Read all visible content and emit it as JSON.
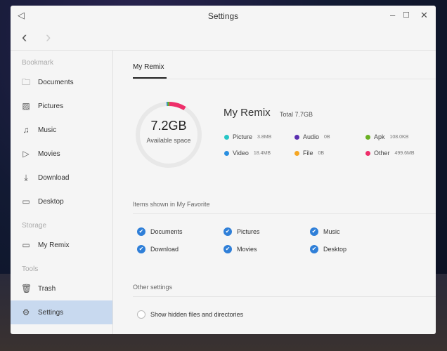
{
  "window": {
    "title": "Settings"
  },
  "sidebar": {
    "bookmark_label": "Bookmark",
    "bookmarks": [
      {
        "label": "Documents",
        "icon": "folder-icon"
      },
      {
        "label": "Pictures",
        "icon": "image-icon"
      },
      {
        "label": "Music",
        "icon": "music-icon"
      },
      {
        "label": "Movies",
        "icon": "play-icon"
      },
      {
        "label": "Download",
        "icon": "download-icon"
      },
      {
        "label": "Desktop",
        "icon": "desktop-icon"
      }
    ],
    "storage_label": "Storage",
    "storage": [
      {
        "label": "My Remix",
        "icon": "monitor-icon"
      }
    ],
    "tools_label": "Tools",
    "tools": [
      {
        "label": "Trash",
        "icon": "trash-icon"
      },
      {
        "label": "Settings",
        "icon": "gear-icon"
      }
    ]
  },
  "main": {
    "tab": "My Remix",
    "disk": {
      "available": "7.2GB",
      "available_label": "Available space",
      "name": "My Remix",
      "total": "Total 7.7GB"
    },
    "legend": [
      {
        "label": "Picture",
        "value": "3.8MB",
        "color": "#26c6c6"
      },
      {
        "label": "Audio",
        "value": "0B",
        "color": "#5a2fb0"
      },
      {
        "label": "Apk",
        "value": "108.0KB",
        "color": "#6ab023"
      },
      {
        "label": "Video",
        "value": "18.4MB",
        "color": "#2a8fe0"
      },
      {
        "label": "File",
        "value": "0B",
        "color": "#f5a623"
      },
      {
        "label": "Other",
        "value": "499.6MB",
        "color": "#ee2e6a"
      }
    ],
    "favorite_heading": "Items shown in My Favorite",
    "favorites": [
      "Documents",
      "Pictures",
      "Music",
      "Download",
      "Movies",
      "Desktop"
    ],
    "other_heading": "Other settings",
    "hidden_files": "Show hidden files and directories"
  }
}
